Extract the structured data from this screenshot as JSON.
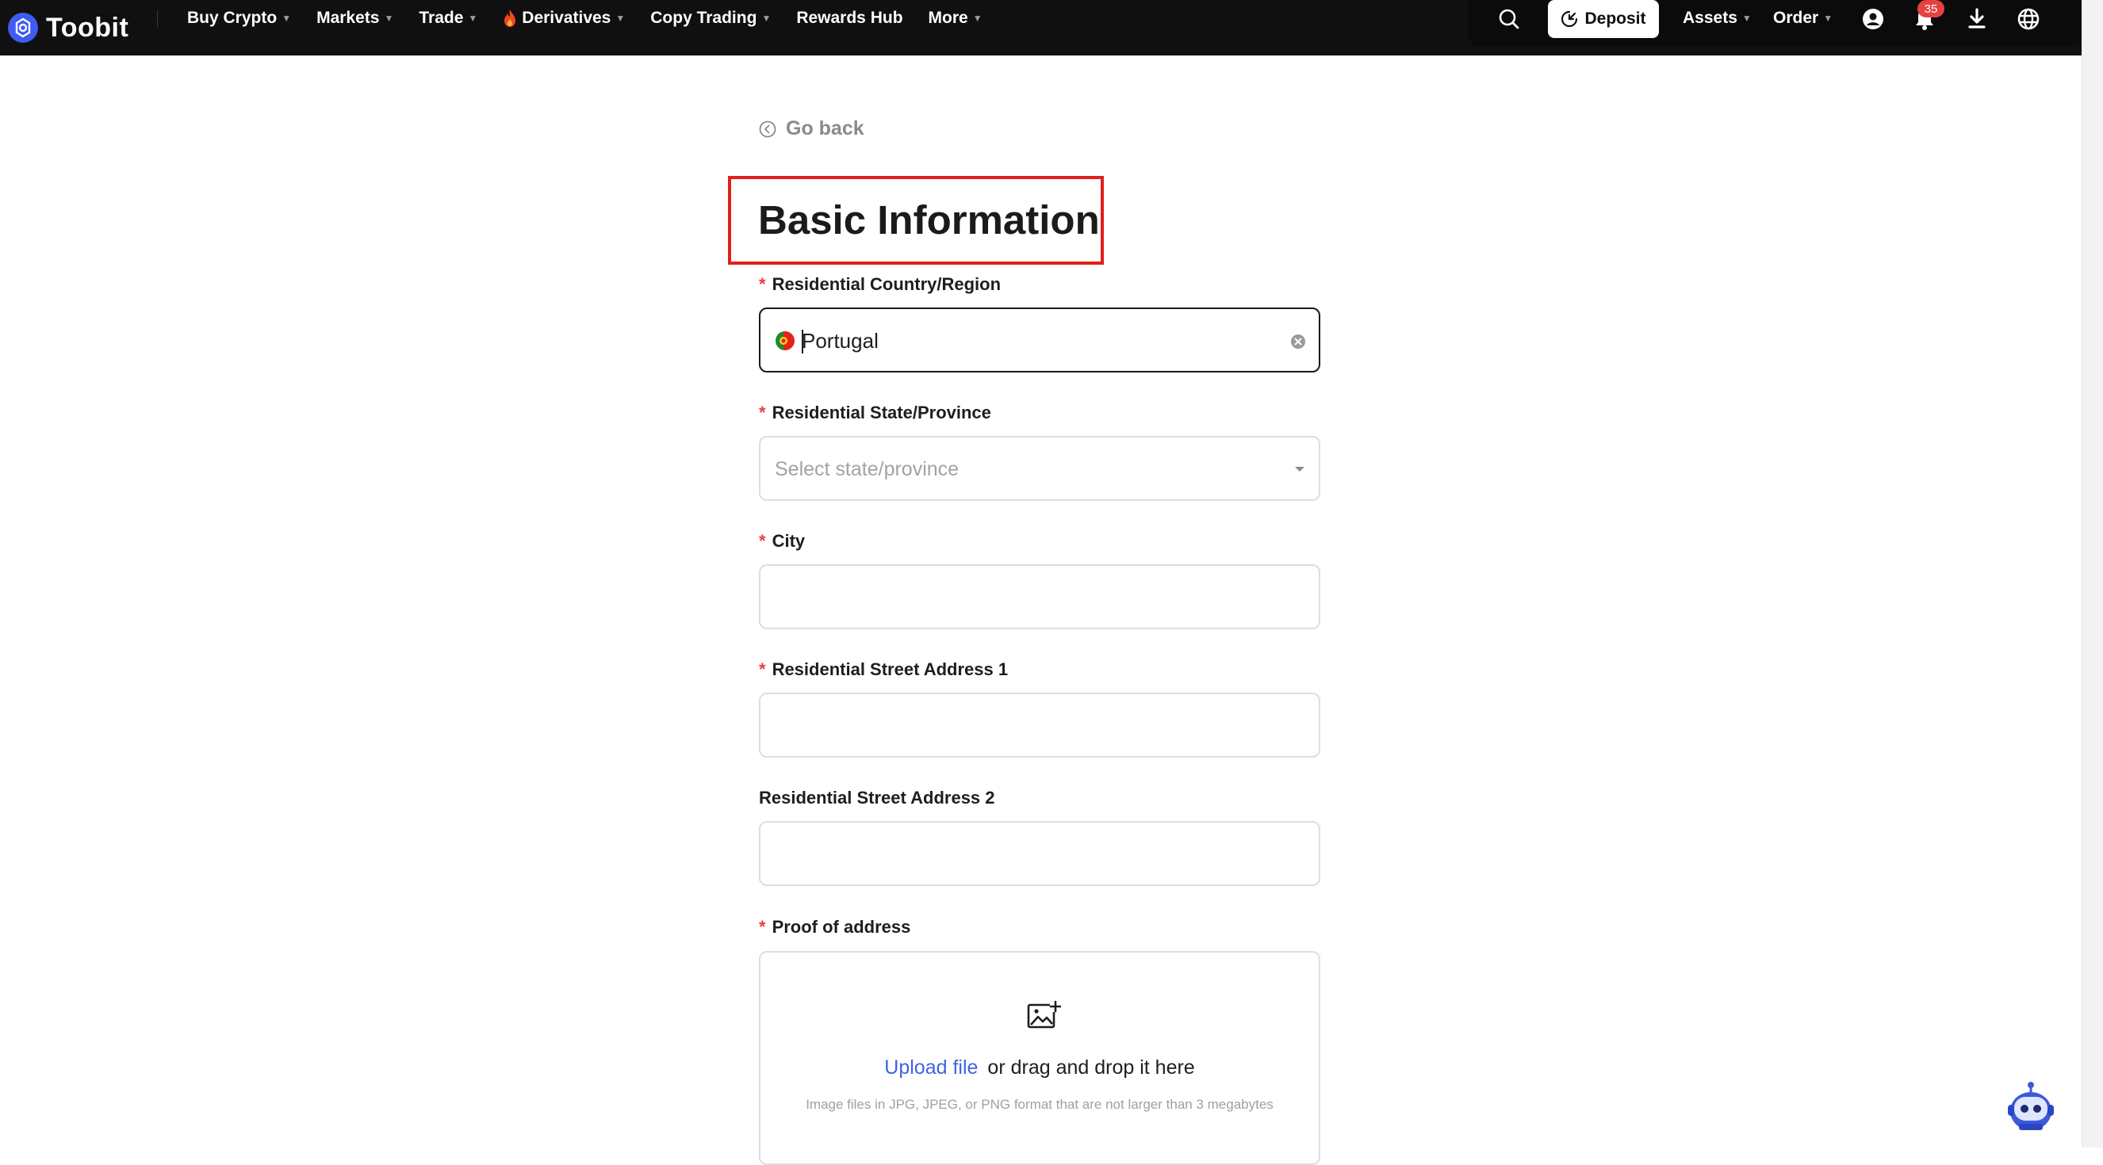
{
  "nav": {
    "brand": "Toobit",
    "menu": [
      {
        "label": "Buy Crypto",
        "caret": true
      },
      {
        "label": "Markets",
        "caret": true
      },
      {
        "label": "Trade",
        "caret": true
      },
      {
        "label": "Derivatives",
        "caret": true,
        "icon": "fire-icon"
      },
      {
        "label": "Copy Trading",
        "caret": true
      },
      {
        "label": "Rewards Hub",
        "caret": false
      },
      {
        "label": "More",
        "caret": true
      }
    ],
    "deposit_label": "Deposit",
    "assets_label": "Assets",
    "order_label": "Order",
    "notification_count": "35",
    "accent_color": "#3e5bf2"
  },
  "form": {
    "go_back": "Go back",
    "title": "Basic Information",
    "required_mark": "*",
    "country": {
      "label": "Residential Country/Region",
      "value": "Portugal",
      "flag": "portugal-flag-icon"
    },
    "state": {
      "label": "Residential State/Province",
      "placeholder": "Select state/province"
    },
    "city": {
      "label": "City",
      "value": ""
    },
    "address1": {
      "label": "Residential Street Address 1",
      "value": ""
    },
    "address2": {
      "label": "Residential Street Address 2",
      "value": ""
    },
    "proof": {
      "label": "Proof of address",
      "upload_link": "Upload file",
      "upload_rest": "or drag and drop it here",
      "hint": "Image files in JPG, JPEG, or PNG format that are not larger than 3 megabytes"
    }
  },
  "colors": {
    "required": "#e5413f",
    "link": "#3f63e0",
    "highlight_box": "#e0201b"
  }
}
